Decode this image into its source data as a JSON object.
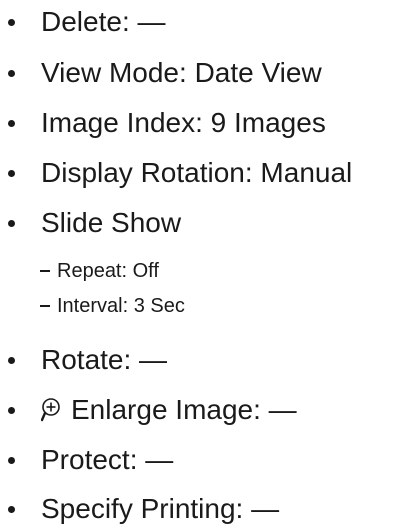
{
  "items": [
    {
      "label": "Delete: —"
    },
    {
      "label": "View Mode: Date View"
    },
    {
      "label": "Image Index: 9 Images"
    },
    {
      "label": "Display Rotation: Manual"
    },
    {
      "label": "Slide Show"
    },
    {
      "label": "Rotate: —"
    },
    {
      "label": "Enlarge Image: —",
      "icon": "zoom-in-icon"
    },
    {
      "label": "Protect: —"
    },
    {
      "label": "Specify Printing: —"
    }
  ],
  "slide_show_subitems": [
    {
      "label": "Repeat: Off"
    },
    {
      "label": "Interval: 3 Sec"
    }
  ]
}
